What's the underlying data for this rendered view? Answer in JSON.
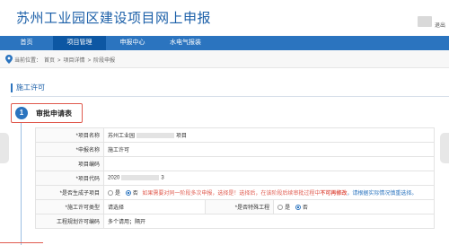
{
  "header": {
    "title": "苏州工业园区建设项目网上申报",
    "logout": "退出"
  },
  "nav": {
    "items": [
      "首页",
      "项目管理",
      "申报中心",
      "水电气报装"
    ]
  },
  "breadcrumb": {
    "prefix": "当前位置：",
    "items": [
      "首页",
      ">",
      "项目详情",
      ">",
      "阶段申报"
    ]
  },
  "section": {
    "title": "施工许可"
  },
  "step": {
    "number": "1",
    "label": "审批申请表"
  },
  "form": {
    "project_name_label": "*项目名称",
    "project_name_value_start": "苏州工业园",
    "project_name_value_end": "项目",
    "declaration_name_label": "*申报名称",
    "declaration_name_value": "施工许可",
    "project_code_label": "项目编码",
    "project_code2_label": "*项目代码",
    "project_code2_value_start": "2020",
    "project_code2_value_end": "3",
    "multi_stage_label": "*是否生成子项目",
    "multi_stage_yes": "是",
    "multi_stage_no": "否",
    "multi_stage_warn": "如果需要对同一阶段多次申报，选择是！选择后，在该阶段后续审批过程中",
    "multi_stage_warn_bold": "不可再修改",
    "multi_stage_note": "，请根据实际情况慎重选择。",
    "permit_type_label": "*施工许可类型",
    "permit_type_placeholder": "请选择",
    "temp_label": "*是否特殊工程",
    "temp_yes": "是",
    "temp_no": "否",
    "plan_permit_label": "工程规划许可编码",
    "plan_permit_placeholder": "多个请用；隔开"
  },
  "colors": {
    "brand_blue": "#2b74bf",
    "nav_active": "#0d57a3",
    "warning_red": "#e05a4e"
  },
  "icons": {
    "location": "map-pin-icon",
    "user": "user-avatar-icon"
  }
}
